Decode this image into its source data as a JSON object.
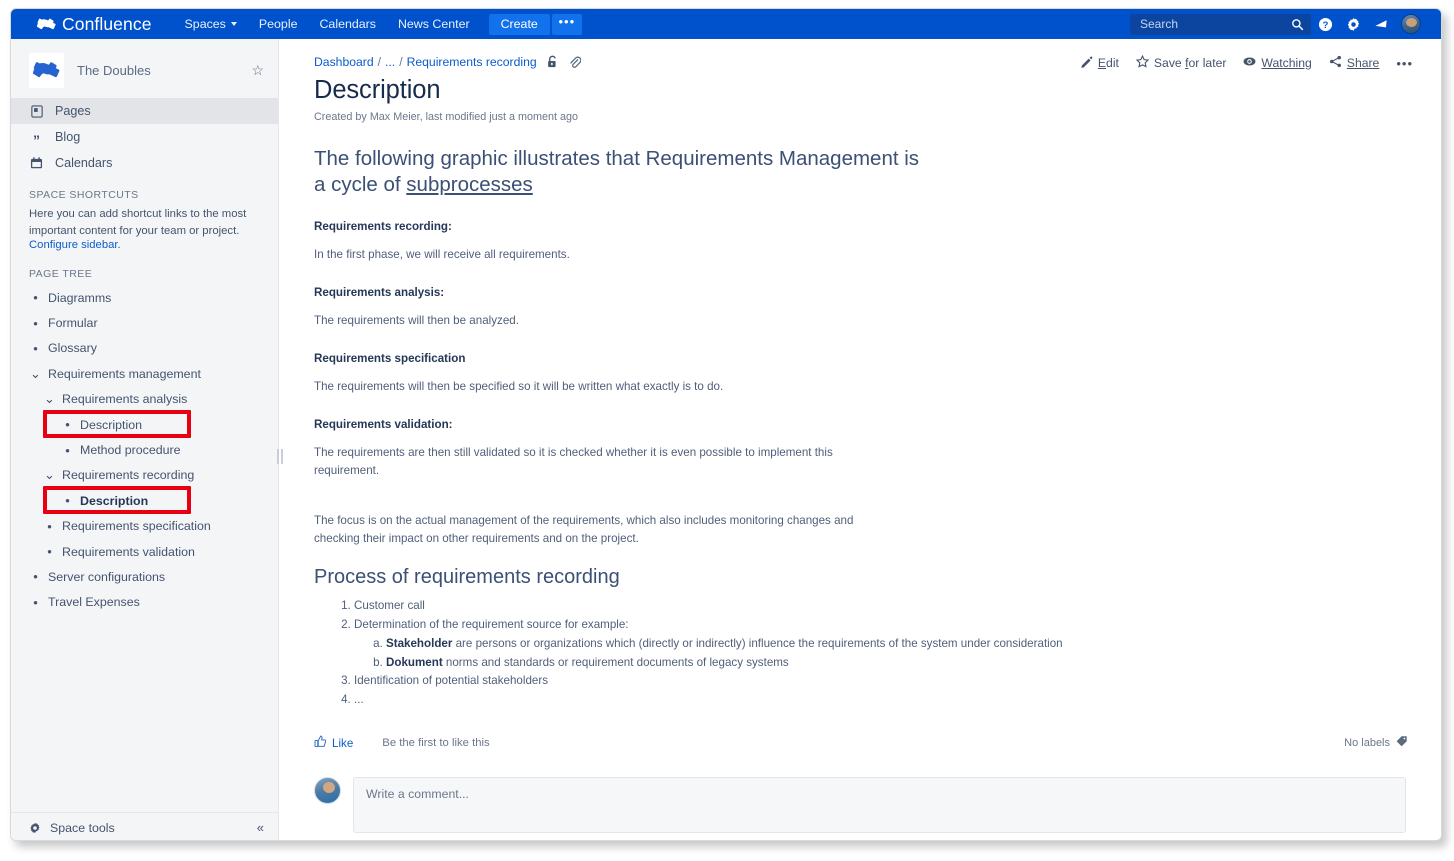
{
  "topnav": {
    "product_name": "Confluence",
    "items": [
      {
        "label": "Spaces",
        "has_caret": true
      },
      {
        "label": "People",
        "has_caret": false
      },
      {
        "label": "Calendars",
        "has_caret": false
      },
      {
        "label": "News Center",
        "has_caret": false
      }
    ],
    "create_label": "Create",
    "more_label": "•••",
    "search_placeholder": "Search",
    "search_value": "",
    "icons": [
      "search-icon",
      "help-icon",
      "settings-icon",
      "notifications-icon",
      "profile-avatar"
    ],
    "brand_color": "#0052cc",
    "create_color": "#1271ec"
  },
  "sidebar": {
    "space_name": "The Doubles",
    "star_glyph": "☆",
    "links": [
      {
        "label": "Pages",
        "icon": "pages-icon",
        "active": true
      },
      {
        "label": "Blog",
        "icon": "blog-quote-icon",
        "active": false
      },
      {
        "label": "Calendars",
        "icon": "calendar-icon",
        "active": false
      }
    ],
    "shortcuts_title": "SPACE SHORTCUTS",
    "shortcuts_help": "Here you can add shortcut links to the most important content for your team or project.",
    "configure_link": "Configure sidebar.",
    "page_tree_title": "PAGE TREE",
    "tree": [
      {
        "label": "Diagramms",
        "level": 0,
        "type": "bullet",
        "current": false,
        "highlight": false
      },
      {
        "label": "Formular",
        "level": 0,
        "type": "bullet",
        "current": false,
        "highlight": false
      },
      {
        "label": "Glossary",
        "level": 0,
        "type": "bullet",
        "current": false,
        "highlight": false
      },
      {
        "label": "Requirements management",
        "level": 0,
        "type": "chevron",
        "current": false,
        "highlight": false
      },
      {
        "label": "Requirements analysis",
        "level": 1,
        "type": "chevron",
        "current": false,
        "highlight": false
      },
      {
        "label": "Description",
        "level": 2,
        "type": "bullet",
        "current": false,
        "highlight": true
      },
      {
        "label": "Method procedure",
        "level": 2,
        "type": "bullet",
        "current": false,
        "highlight": false
      },
      {
        "label": "Requirements recording",
        "level": 1,
        "type": "chevron",
        "current": false,
        "highlight": false
      },
      {
        "label": "Description",
        "level": 2,
        "type": "bullet",
        "current": true,
        "highlight": true
      },
      {
        "label": "Requirements specification",
        "level": 1,
        "type": "bullet",
        "current": false,
        "highlight": false
      },
      {
        "label": "Requirements validation",
        "level": 1,
        "type": "bullet",
        "current": false,
        "highlight": false
      },
      {
        "label": "Server configurations",
        "level": 0,
        "type": "bullet",
        "current": false,
        "highlight": false
      },
      {
        "label": "Travel Expenses",
        "level": 0,
        "type": "bullet",
        "current": false,
        "highlight": false
      }
    ],
    "space_tools_label": "Space tools",
    "collapse_glyph": "«",
    "highlight_color": "#e60012"
  },
  "breadcrumb": {
    "dashboard": "Dashboard",
    "sep1": "/",
    "ellipsis": "...",
    "sep2": "/",
    "parent": "Requirements recording"
  },
  "page_actions": [
    {
      "name": "edit",
      "icon": "pencil-icon",
      "accesskey": "E",
      "rest": "dit"
    },
    {
      "name": "save-for-later",
      "icon": "star-icon",
      "pre": "Save ",
      "accesskey": "f",
      "rest": "or later"
    },
    {
      "name": "watching",
      "icon": "eye-icon",
      "accesskey": "W",
      "rest": "atching"
    },
    {
      "name": "share",
      "icon": "share-icon",
      "accesskey": "S",
      "rest": "hare"
    },
    {
      "name": "more",
      "icon": "ellipsis-icon",
      "glyph": "•••"
    }
  ],
  "page": {
    "title": "Description",
    "meta": "Created by Max Meier, last modified just a moment ago",
    "intro_part1": "The following graphic illustrates that Requirements Management is a cycle of ",
    "intro_link": "subprocesses",
    "sections": [
      {
        "heading": "Requirements recording:",
        "body": "In the first phase, we will receive all requirements."
      },
      {
        "heading": "Requirements analysis:",
        "body": "The requirements will then be analyzed."
      },
      {
        "heading": "Requirements specification",
        "body": "The requirements will then be specified so it will be written what exactly is to do."
      },
      {
        "heading": "Requirements validation:",
        "body": "The requirements are then still validated so it is checked whether it is even possible to implement this requirement."
      }
    ],
    "focus_paragraph": "The focus is on the actual management of the requirements, which also includes monitoring changes and checking their impact on other requirements and on the project.",
    "process_heading": "Process of requirements recording",
    "process_list": [
      {
        "text": "Customer call"
      },
      {
        "text": "Determination of the requirement source for example:",
        "sub": [
          {
            "bold": "Stakeholder",
            "text": " are persons or organizations which (directly or indirectly) influence the requirements of the system under consideration"
          },
          {
            "bold": "Dokument",
            "text": " norms and standards or requirement documents of legacy systems"
          }
        ]
      },
      {
        "text": "Identification of potential stakeholders"
      },
      {
        "text": "..."
      }
    ]
  },
  "footer": {
    "like_label": "Like",
    "like_note": "Be the first to like this",
    "labels_text": "No labels",
    "comment_placeholder": "Write a comment...",
    "comment_value": ""
  }
}
